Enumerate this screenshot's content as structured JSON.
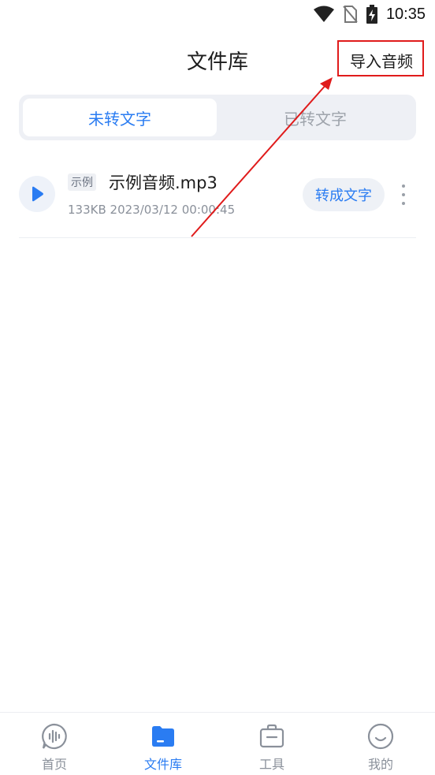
{
  "status_bar": {
    "time": "10:35"
  },
  "header": {
    "title": "文件库",
    "import_label": "导入音频"
  },
  "tabs": [
    {
      "label": "未转文字",
      "active": true
    },
    {
      "label": "已转文字",
      "active": false
    }
  ],
  "files": [
    {
      "tag": "示例",
      "name": "示例音频.mp3",
      "meta": "133KB 2023/03/12 00:00:45",
      "convert_label": "转成文字"
    }
  ],
  "bottom_nav": [
    {
      "label": "首页",
      "icon": "voice-chat-icon",
      "active": false
    },
    {
      "label": "文件库",
      "icon": "folder-icon",
      "active": true
    },
    {
      "label": "工具",
      "icon": "toolbox-icon",
      "active": false
    },
    {
      "label": "我的",
      "icon": "smiley-icon",
      "active": false
    }
  ],
  "colors": {
    "accent": "#2a7cf2",
    "annotation": "#e01b1b"
  }
}
